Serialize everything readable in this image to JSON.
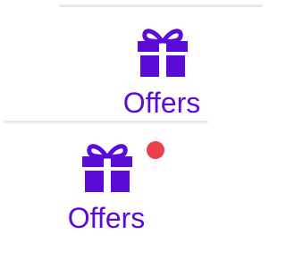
{
  "colors": {
    "accent": "#5a0bd6",
    "notification": "#eb3f4c",
    "divider": "#e9e9ee"
  },
  "tabs": [
    {
      "icon": "gift-icon",
      "label": "Offers",
      "has_notification": false
    },
    {
      "icon": "gift-icon",
      "label": "Offers",
      "has_notification": true
    }
  ]
}
